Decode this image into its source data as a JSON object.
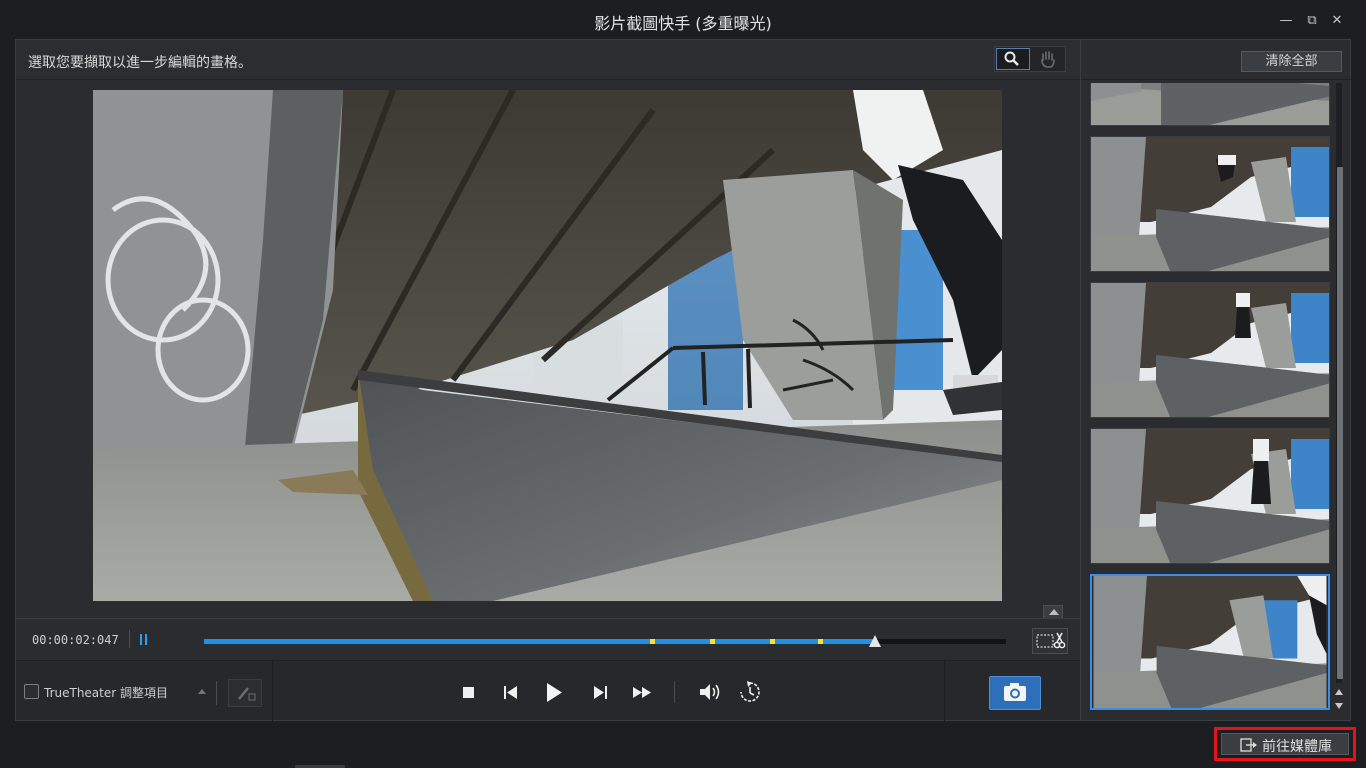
{
  "window": {
    "title": "影片截圖快手 (多重曝光)",
    "minimize_glyph": "—",
    "restore_glyph": "⧉",
    "close_glyph": "✕"
  },
  "main": {
    "hint": "選取您要擷取以進一步編輯的畫格。",
    "tools": [
      "zoom-icon",
      "hand-icon"
    ]
  },
  "timeline": {
    "timecode": "00:00:02:047",
    "progress": 0.837,
    "markers": [
      0.559,
      0.633,
      0.708,
      0.768
    ],
    "playhead": 0.837
  },
  "controls": {
    "truetheater_label": "TrueTheater 調整項目",
    "truetheater_checked": false,
    "buttons": [
      "stop-icon",
      "previous-frame-icon",
      "play-icon",
      "next-frame-icon",
      "fast-forward-icon",
      "volume-icon",
      "rotate-icon"
    ]
  },
  "right_panel": {
    "clear_all_label": "清除全部",
    "thumbnail_count": 5,
    "selected_index": 4
  },
  "footer": {
    "library_label": "前往媒體庫"
  },
  "colors": {
    "accent": "#1e90e8",
    "marker": "#f2e23a",
    "highlight": "#e5141c"
  }
}
